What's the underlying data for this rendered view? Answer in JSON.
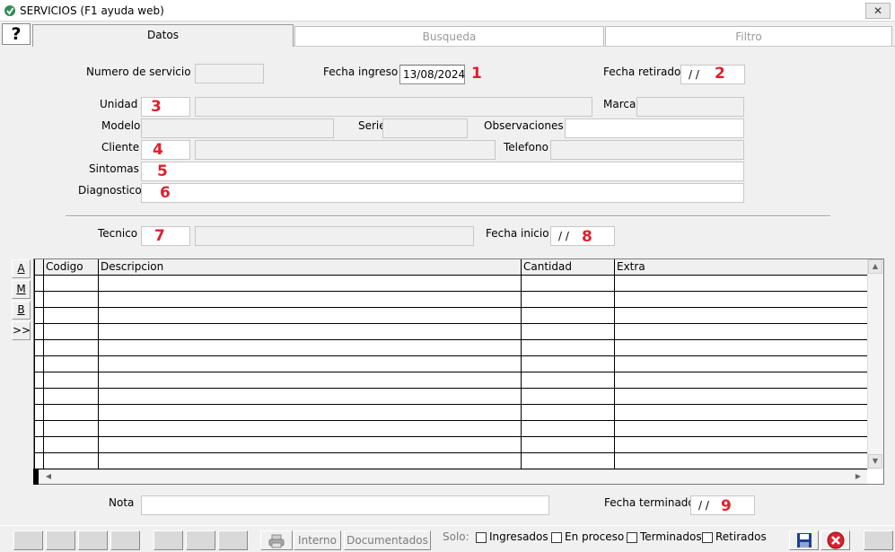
{
  "window": {
    "title": "SERVICIOS (F1 ayuda web)",
    "close_glyph": "✕"
  },
  "help_glyph": "?",
  "tabs": [
    {
      "label": "Datos",
      "active": true
    },
    {
      "label": "Busqueda",
      "active": false
    },
    {
      "label": "Filtro",
      "active": false
    }
  ],
  "form": {
    "numero_servicio_label": "Numero de servicio",
    "fecha_ingreso_label": "Fecha ingreso",
    "fecha_ingreso_value": "13/08/2024",
    "fecha_retirado_label": "Fecha retirado",
    "fecha_retirado_value": "/ /",
    "unidad_label": "Unidad",
    "marca_label": "Marca",
    "modelo_label": "Modelo",
    "serie_label": "Serie",
    "observaciones_label": "Observaciones",
    "cliente_label": "Cliente",
    "telefono_label": "Telefono",
    "sintomas_label": "Sintomas",
    "diagnostico_label": "Diagnostico",
    "tecnico_label": "Tecnico",
    "fecha_inicio_label": "Fecha inicio",
    "fecha_inicio_value": "/ /",
    "nota_label": "Nota",
    "fecha_terminado_label": "Fecha terminado",
    "fecha_terminado_value": "/ /"
  },
  "markers": [
    "1",
    "2",
    "3",
    "4",
    "5",
    "6",
    "7",
    "8",
    "9"
  ],
  "side_buttons": [
    "A",
    "M",
    "B",
    ">>"
  ],
  "grid": {
    "columns": [
      "Codigo",
      "Descripcion",
      "Cantidad",
      "Extra"
    ],
    "row_count": 12
  },
  "status": {
    "interno_label": "Interno",
    "documentados_label": "Documentados",
    "solo_label": "Solo:",
    "filters": [
      "Ingresados",
      "En proceso",
      "Terminados",
      "Retirados"
    ]
  },
  "colors": {
    "marker": "#e0202d",
    "save_icon": "#1f3f8f",
    "cancel_icon": "#d9232d"
  }
}
